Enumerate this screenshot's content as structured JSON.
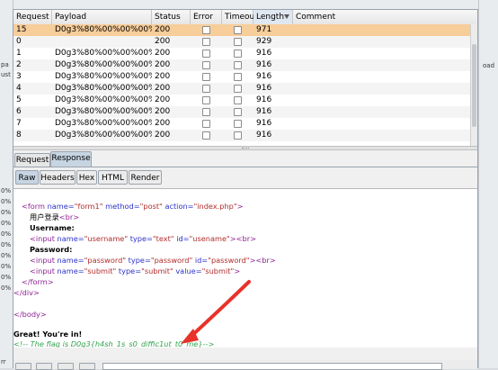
{
  "background": {
    "left_labels": [
      "pa",
      "ust",
      "0%",
      "0%",
      "0%",
      "0%",
      "0%",
      "0%",
      "0%",
      "0%",
      "0%",
      "0%",
      "rr"
    ],
    "right_label": "oad"
  },
  "table": {
    "columns": [
      "Request",
      "Payload",
      "Status",
      "Error",
      "Timeout",
      "Length",
      "Comment"
    ],
    "sorted_column": "Length",
    "rows": [
      {
        "request": "15",
        "payload": "D0g3%80%00%00%00%0...",
        "status": "200",
        "length": "971",
        "selected": true
      },
      {
        "request": "0",
        "payload": "",
        "status": "200",
        "length": "929",
        "selected": false
      },
      {
        "request": "1",
        "payload": "D0g3%80%00%00%00%0...",
        "status": "200",
        "length": "916",
        "selected": false
      },
      {
        "request": "2",
        "payload": "D0g3%80%00%00%00%0...",
        "status": "200",
        "length": "916",
        "selected": false
      },
      {
        "request": "3",
        "payload": "D0g3%80%00%00%00%0...",
        "status": "200",
        "length": "916",
        "selected": false
      },
      {
        "request": "4",
        "payload": "D0g3%80%00%00%00%0...",
        "status": "200",
        "length": "916",
        "selected": false
      },
      {
        "request": "5",
        "payload": "D0g3%80%00%00%00%0...",
        "status": "200",
        "length": "916",
        "selected": false
      },
      {
        "request": "6",
        "payload": "D0g3%80%00%00%00%0...",
        "status": "200",
        "length": "916",
        "selected": false
      },
      {
        "request": "7",
        "payload": "D0g3%80%00%00%00%0...",
        "status": "200",
        "length": "916",
        "selected": false
      },
      {
        "request": "8",
        "payload": "D0g3%80%00%00%00%0...",
        "status": "200",
        "length": "916",
        "selected": false
      }
    ]
  },
  "tabs": [
    "Request",
    "Response"
  ],
  "active_tab": "Response",
  "view_tabs": [
    "Raw",
    "Headers",
    "Hex",
    "HTML",
    "Render"
  ],
  "active_view_tab": "Raw",
  "response_lines": {
    "form_open": {
      "lt": "<",
      "tag": "form",
      "a1": "name=",
      "v1": "\"form1\"",
      "a2": "method=",
      "v2": "\"post\"",
      "a3": "action=",
      "v3": "\"index.php\"",
      "gt": ">"
    },
    "login_text": "用户登录",
    "br": "<br>",
    "username_label": "Username:",
    "input_user": {
      "lt": "<",
      "tag": "input",
      "a1": "name=",
      "v1": "\"username\"",
      "a2": "type=",
      "v2": "\"text\"",
      "a3": "id=",
      "v3": "\"usename\"",
      "gt": "><br>"
    },
    "password_label": "Password:",
    "input_pass": {
      "lt": "<",
      "tag": "input",
      "a1": "name=",
      "v1": "\"password\"",
      "a2": "type=",
      "v2": "\"password\"",
      "a3": "id=",
      "v3": "\"password\"",
      "gt": "><br>"
    },
    "input_submit": {
      "lt": "<",
      "tag": "input",
      "a1": "name=",
      "v1": "\"submit\"",
      "a2": "type=",
      "v2": "\"submit\"",
      "a3": "value=",
      "v3": "\"submit\"",
      "gt": ">"
    },
    "form_close": "</form>",
    "div_close": "</div>",
    "body_close": "</body>",
    "success": "Great! You're in!",
    "flag_comment": "<!-- The flag is D0g3{h4sh_1s_s0_diffic1ut_t0_me}-->"
  },
  "colors": {
    "selected_row": "#f7cd9a",
    "active_tab": "#c7d5e3",
    "arrow": "#e8322a",
    "comment": "#33a24f"
  }
}
